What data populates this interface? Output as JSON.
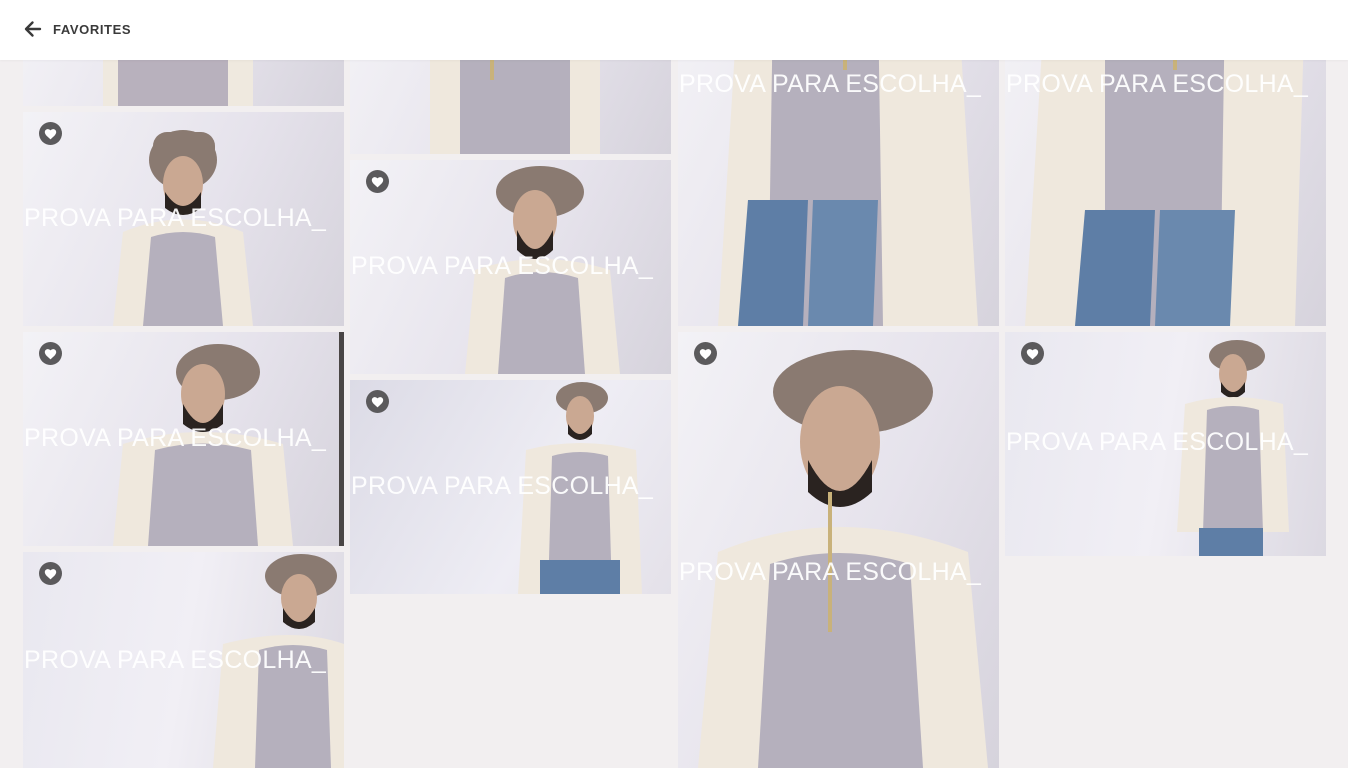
{
  "header": {
    "back_icon": "arrow-left-icon",
    "title": "FAVORITES"
  },
  "watermark": "PROVA PARA ESCOLHA_",
  "heart_icon": "heart-icon",
  "colors": {
    "background": "#f2eff0",
    "topbar": "#ffffff",
    "heart_badge": "#5b5a5c"
  }
}
